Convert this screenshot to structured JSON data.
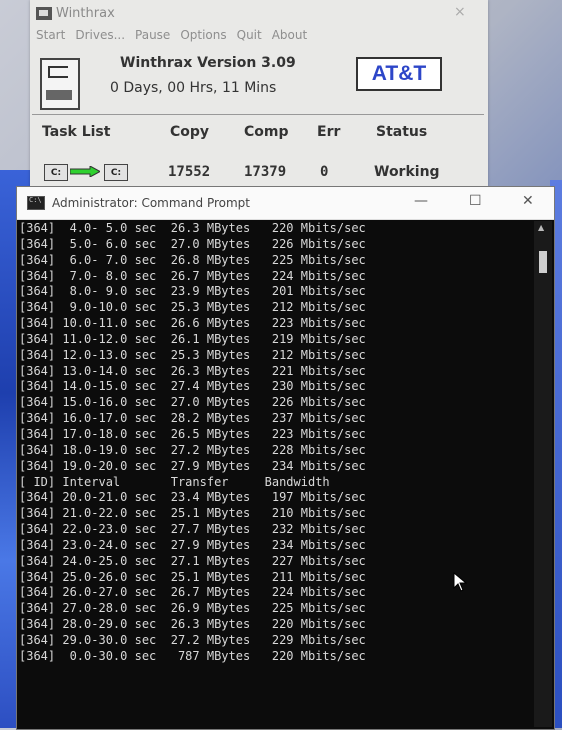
{
  "winthrax": {
    "title": "Winthrax",
    "close_glyph": "×",
    "menu": [
      "Start",
      "Drives...",
      "Pause",
      "Options",
      "Quit",
      "About"
    ],
    "version": "Winthrax Version 3.09",
    "uptime": "0 Days, 00 Hrs, 11 Mins",
    "brand": "AT&T",
    "headers": {
      "task": "Task List",
      "copy": "Copy",
      "comp": "Comp",
      "err": "Err",
      "status": "Status"
    },
    "row": {
      "src": "C:",
      "dst": "C:",
      "copy": "17552",
      "comp": "17379",
      "err": "0",
      "status": "Working"
    },
    "colors": {
      "brand_text": "#2d46c8",
      "arrow_fill": "#2fd12f"
    }
  },
  "cmd": {
    "title": "Administrator: Command Prompt",
    "controls": {
      "minimize": "—",
      "maximize": "☐",
      "close": "✕"
    },
    "lines": [
      "[364]  4.0- 5.0 sec  26.3 MBytes   220 Mbits/sec",
      "[364]  5.0- 6.0 sec  27.0 MBytes   226 Mbits/sec",
      "[364]  6.0- 7.0 sec  26.8 MBytes   225 Mbits/sec",
      "[364]  7.0- 8.0 sec  26.7 MBytes   224 Mbits/sec",
      "[364]  8.0- 9.0 sec  23.9 MBytes   201 Mbits/sec",
      "[364]  9.0-10.0 sec  25.3 MBytes   212 Mbits/sec",
      "[364] 10.0-11.0 sec  26.6 MBytes   223 Mbits/sec",
      "[364] 11.0-12.0 sec  26.1 MBytes   219 Mbits/sec",
      "[364] 12.0-13.0 sec  25.3 MBytes   212 Mbits/sec",
      "[364] 13.0-14.0 sec  26.3 MBytes   221 Mbits/sec",
      "[364] 14.0-15.0 sec  27.4 MBytes   230 Mbits/sec",
      "[364] 15.0-16.0 sec  27.0 MBytes   226 Mbits/sec",
      "[364] 16.0-17.0 sec  28.2 MBytes   237 Mbits/sec",
      "[364] 17.0-18.0 sec  26.5 MBytes   223 Mbits/sec",
      "[364] 18.0-19.0 sec  27.2 MBytes   228 Mbits/sec",
      "[364] 19.0-20.0 sec  27.9 MBytes   234 Mbits/sec",
      "[ ID] Interval       Transfer     Bandwidth",
      "[364] 20.0-21.0 sec  23.4 MBytes   197 Mbits/sec",
      "[364] 21.0-22.0 sec  25.1 MBytes   210 Mbits/sec",
      "[364] 22.0-23.0 sec  27.7 MBytes   232 Mbits/sec",
      "[364] 23.0-24.0 sec  27.9 MBytes   234 Mbits/sec",
      "[364] 24.0-25.0 sec  27.1 MBytes   227 Mbits/sec",
      "[364] 25.0-26.0 sec  25.1 MBytes   211 Mbits/sec",
      "[364] 26.0-27.0 sec  26.7 MBytes   224 Mbits/sec",
      "[364] 27.0-28.0 sec  26.9 MBytes   225 Mbits/sec",
      "[364] 28.0-29.0 sec  26.3 MBytes   220 Mbits/sec",
      "[364] 29.0-30.0 sec  27.2 MBytes   229 Mbits/sec",
      "[364]  0.0-30.0 sec   787 MBytes   220 Mbits/sec"
    ],
    "colors": {
      "console_bg": "#0c0c0c",
      "console_text": "#d9d9d9"
    }
  }
}
